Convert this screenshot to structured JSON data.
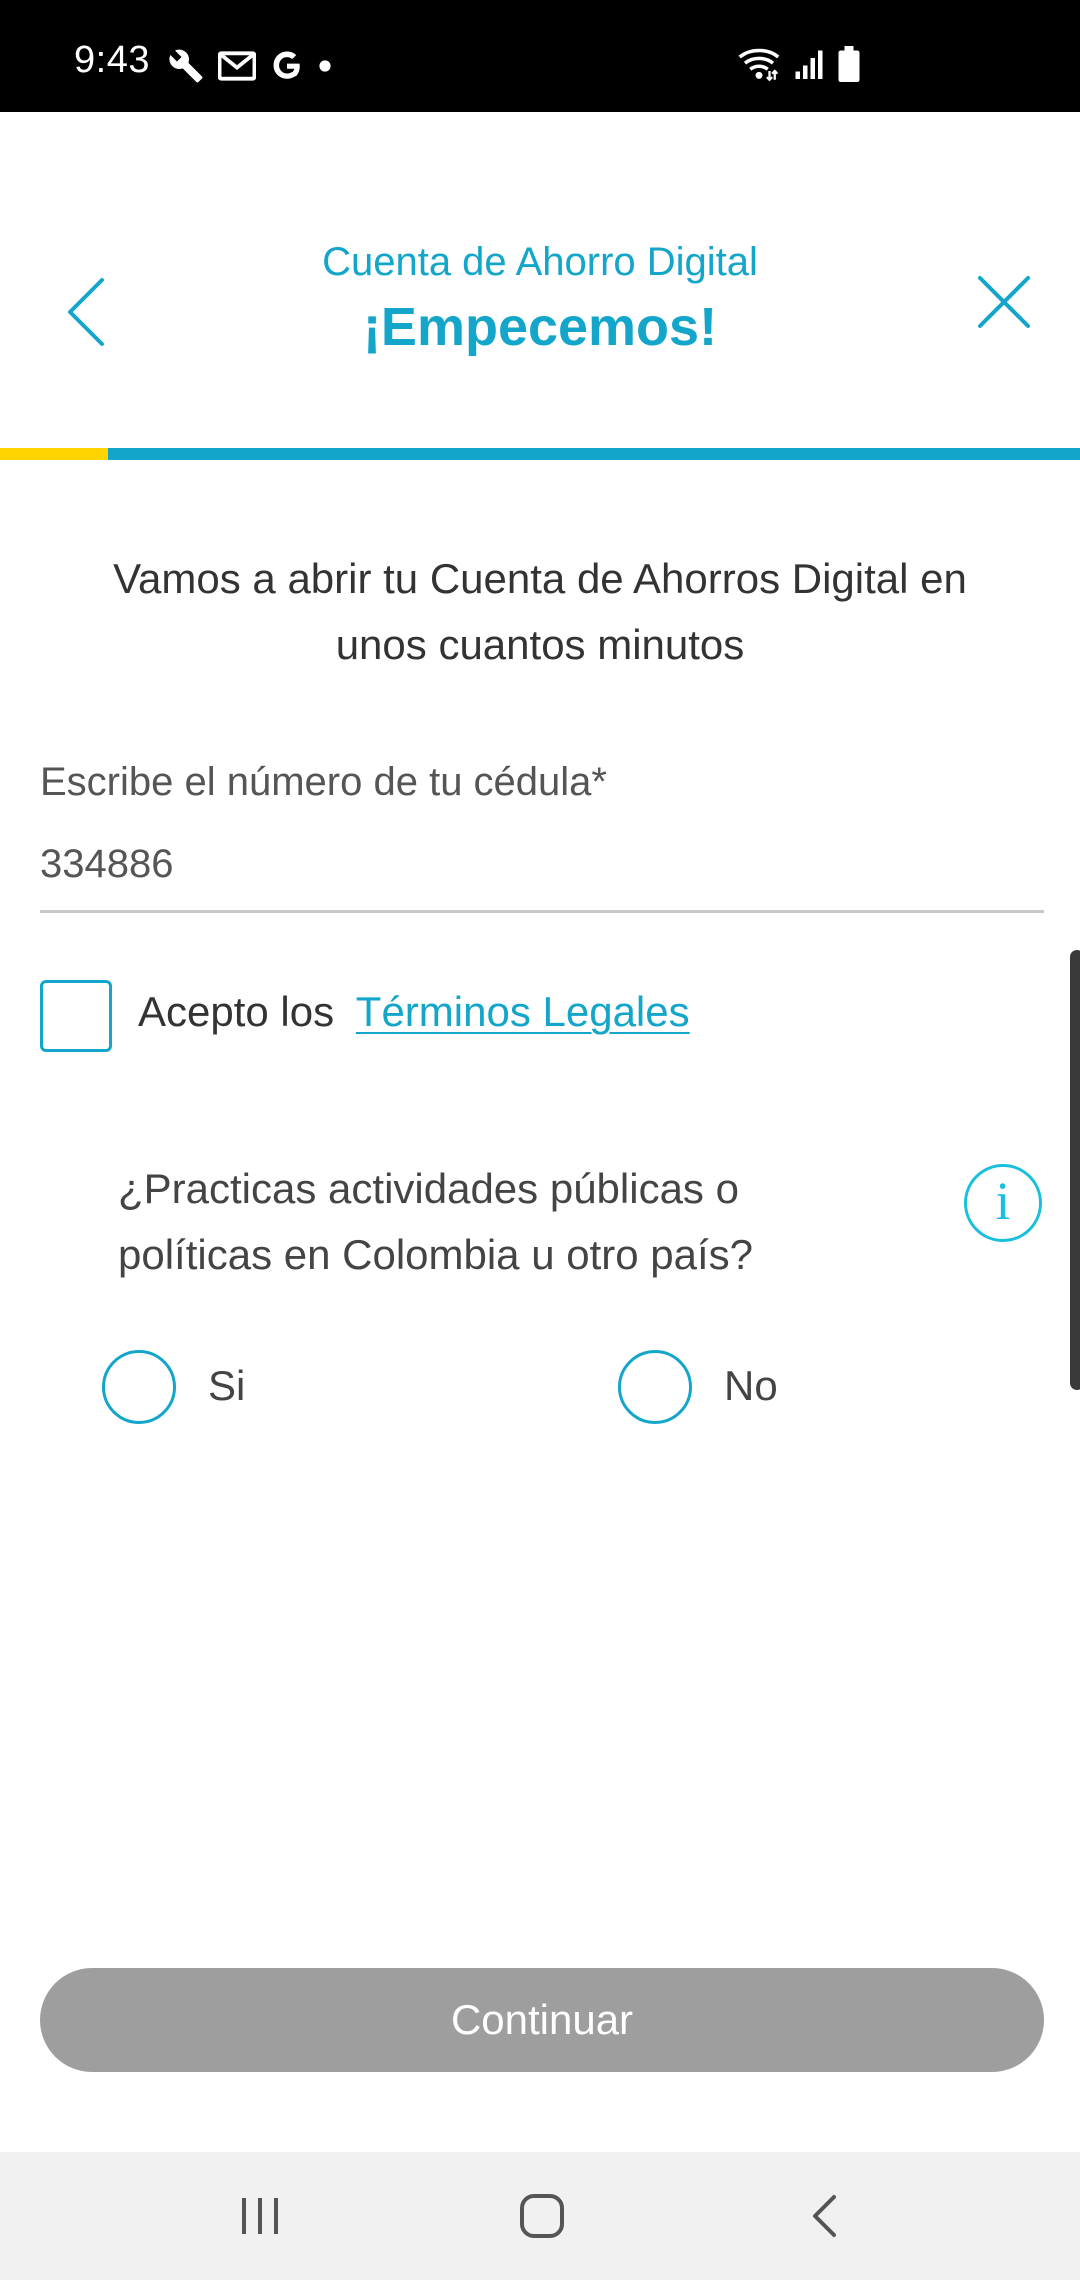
{
  "status_bar": {
    "time": "9:43",
    "left_icons": [
      "wrench-icon",
      "gmail-icon",
      "google-icon",
      "dot-icon"
    ],
    "right_icons": [
      "wifi-icon",
      "signal-icon",
      "battery-icon"
    ]
  },
  "header": {
    "subtitle": "Cuenta de Ahorro Digital",
    "title": "¡Empecemos!",
    "back_icon": "chevron-left-icon",
    "close_icon": "close-icon"
  },
  "progress": {
    "fraction": 0.1,
    "fill_color": "#ffd400",
    "track_color": "#13a6ca"
  },
  "intro": {
    "text": "Vamos a abrir tu Cuenta de Ahorros Digital en unos cuantos minutos"
  },
  "id_field": {
    "label": "Escribe el número de tu cédula*",
    "value": "334886"
  },
  "terms": {
    "checked": false,
    "prefix": "Acepto los",
    "link": "Términos Legales"
  },
  "question": {
    "text": "¿Practicas actividades públicas o políticas en Colombia u otro país?",
    "info_icon": "info-icon",
    "options": [
      {
        "label": "Si",
        "selected": false
      },
      {
        "label": "No",
        "selected": false
      }
    ]
  },
  "continue_button": {
    "label": "Continuar",
    "enabled": false
  },
  "nav_bar": {
    "items": [
      "recent-apps-icon",
      "home-icon",
      "back-icon"
    ]
  },
  "colors": {
    "accent": "#13a6ca",
    "progress_fill": "#ffd400",
    "disabled_button": "#9e9e9e"
  }
}
